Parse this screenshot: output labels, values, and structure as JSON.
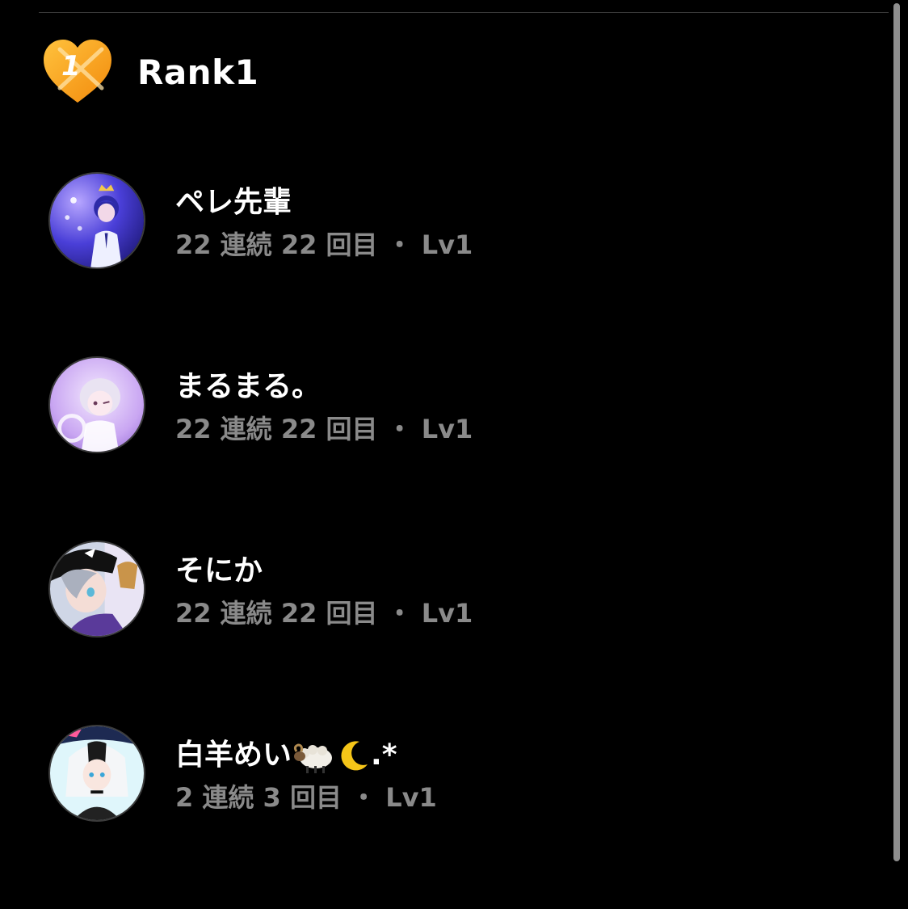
{
  "header": {
    "rank_badge_digit": "1",
    "rank_label": "Rank1"
  },
  "colors": {
    "background": "#000000",
    "primary_text": "#ffffff",
    "secondary_text": "#8a8a8a",
    "badge_orange": "#f7a21b"
  },
  "users": [
    {
      "name": "ペレ先輩",
      "stats": "22 連続 22 回目 ・ Lv1"
    },
    {
      "name": "まるまる。",
      "stats": "22 連続 22 回目 ・ Lv1"
    },
    {
      "name": "そにか",
      "stats": "22 連続 22 回目 ・ Lv1"
    },
    {
      "name": "白羊めい",
      "name_suffix": ".*",
      "stats": "2 連続 3 回目 ・ Lv1"
    }
  ]
}
